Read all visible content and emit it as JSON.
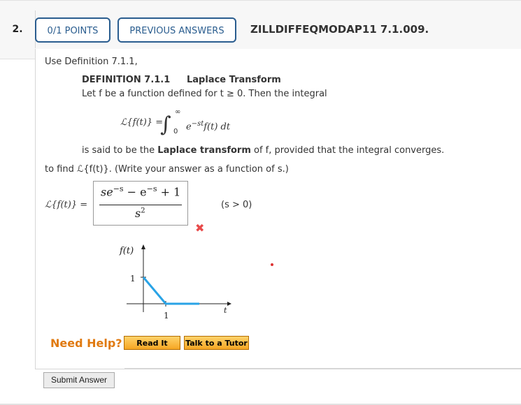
{
  "header": {
    "question_number": "2.",
    "points_label": "0/1 POINTS",
    "previous_answers_label": "PREVIOUS ANSWERS",
    "question_id": "ZILLDIFFEQMODAP11 7.1.009."
  },
  "problem": {
    "intro": "Use Definition 7.1.1,",
    "definition_title": "DEFINITION 7.1.1",
    "definition_name": "Laplace Transform",
    "definition_lead": "Let f be a function defined for t ≥ 0. Then the integral",
    "integral_lhs": "ℒ{f(t)} =",
    "integral_upper": "∞",
    "integral_lower": "0",
    "integrand": "e",
    "integrand_exp": "−st",
    "integrand_rest": "f(t) dt",
    "def_after_1": "is said to be the ",
    "def_after_bold": "Laplace transform",
    "def_after_2": " of f, provided that the integral converges.",
    "task": "to find ℒ{f(t)}. (Write your answer as a function of s.)"
  },
  "answer": {
    "lhs": "ℒ{f(t)} =",
    "numerator_se": "se",
    "numerator_exp1": "−s",
    "numerator_mid": " − e",
    "numerator_exp2": "−s",
    "numerator_tail": " + 1",
    "denominator_base": "s",
    "denominator_exp": "2",
    "condition": "(s > 0)",
    "status": "incorrect",
    "status_color": "#e84a4a"
  },
  "graph": {
    "y_axis_label": "f(t)",
    "x_axis_label": "t",
    "y_tick": "1",
    "x_tick": "1",
    "line_color": "#29a3e6",
    "series": [
      {
        "t": 0,
        "f": 1
      },
      {
        "t": 1,
        "f": 0
      },
      {
        "t": 2.5,
        "f": 0
      }
    ]
  },
  "help": {
    "need_help": "Need Help?",
    "read_it": "Read It",
    "talk_tutor": "Talk to a Tutor"
  },
  "submit_label": "Submit Answer"
}
